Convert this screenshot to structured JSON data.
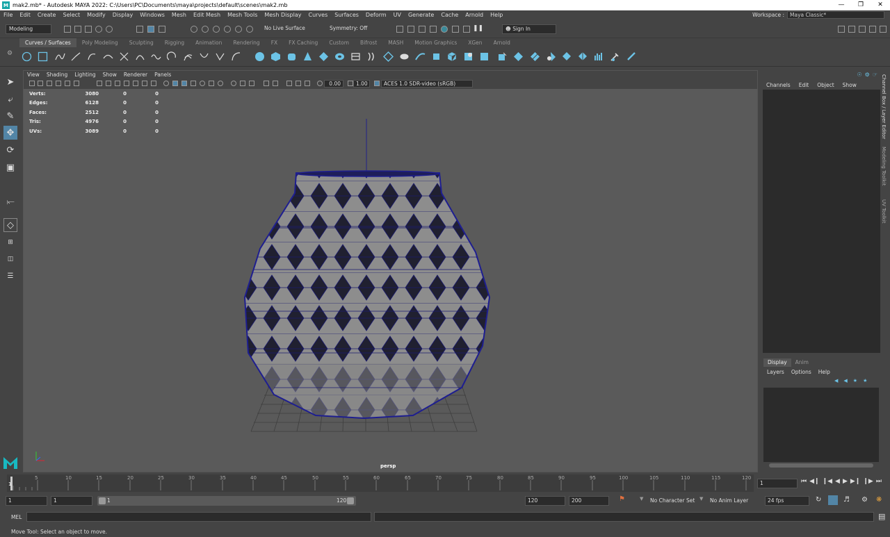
{
  "title": "mak2.mb* - Autodesk MAYA 2022: C:\\Users\\PC\\Documents\\maya\\projects\\default\\scenes\\mak2.mb",
  "menu": [
    "File",
    "Edit",
    "Create",
    "Select",
    "Modify",
    "Display",
    "Windows",
    "Mesh",
    "Edit Mesh",
    "Mesh Tools",
    "Mesh Display",
    "Curves",
    "Surfaces",
    "Deform",
    "UV",
    "Generate",
    "Cache",
    "Arnold",
    "Help"
  ],
  "workspace": {
    "label": "Workspace :",
    "value": "Maya Classic*"
  },
  "statusline": {
    "mode": "Modeling",
    "live_surface": "No Live Surface",
    "symmetry": "Symmetry: Off",
    "sign_in": "Sign In"
  },
  "shelf_tabs": [
    "Curves / Surfaces",
    "Poly Modeling",
    "Sculpting",
    "Rigging",
    "Animation",
    "Rendering",
    "FX",
    "FX Caching",
    "Custom",
    "Bifrost",
    "MASH",
    "Motion Graphics",
    "XGen",
    "Arnold"
  ],
  "viewport": {
    "menu": [
      "View",
      "Shading",
      "Lighting",
      "Show",
      "Renderer",
      "Panels"
    ],
    "exposure": "0.00",
    "gamma": "1.00",
    "colorspace": "ACES 1.0 SDR-video (sRGB)",
    "camera": "persp",
    "hud": [
      {
        "label": "Verts:",
        "v1": "3080",
        "v2": "0",
        "v3": "0"
      },
      {
        "label": "Edges:",
        "v1": "6128",
        "v2": "0",
        "v3": "0"
      },
      {
        "label": "Faces:",
        "v1": "2512",
        "v2": "0",
        "v3": "0"
      },
      {
        "label": "Tris:",
        "v1": "4976",
        "v2": "0",
        "v3": "0"
      },
      {
        "label": "UVs:",
        "v1": "3089",
        "v2": "0",
        "v3": "0"
      }
    ]
  },
  "channelbox": {
    "menu": [
      "Channels",
      "Edit",
      "Object",
      "Show"
    ]
  },
  "side_tabs": [
    "Channel Box / Layer Editor",
    "Modeling Toolkit",
    "UV Toolkit"
  ],
  "layer_editor": {
    "tabs": [
      "Display",
      "Anim"
    ],
    "menu": [
      "Layers",
      "Options",
      "Help"
    ]
  },
  "timeline": {
    "ticks": [
      "5",
      "10",
      "15",
      "20",
      "25",
      "30",
      "35",
      "40",
      "45",
      "50",
      "55",
      "60",
      "65",
      "70",
      "75",
      "80",
      "85",
      "90",
      "95",
      "100",
      "105",
      "110",
      "115",
      "120"
    ],
    "first": "1",
    "current": "1"
  },
  "range": {
    "start": "1",
    "start2": "1",
    "slider_start": "1",
    "slider_end": "120",
    "end": "120",
    "end2": "200",
    "char_set": "No Character Set",
    "anim_layer": "No Anim Layer",
    "fps": "24 fps"
  },
  "cmdline": {
    "label": "MEL"
  },
  "helpline": "Move Tool: Select an object to move."
}
